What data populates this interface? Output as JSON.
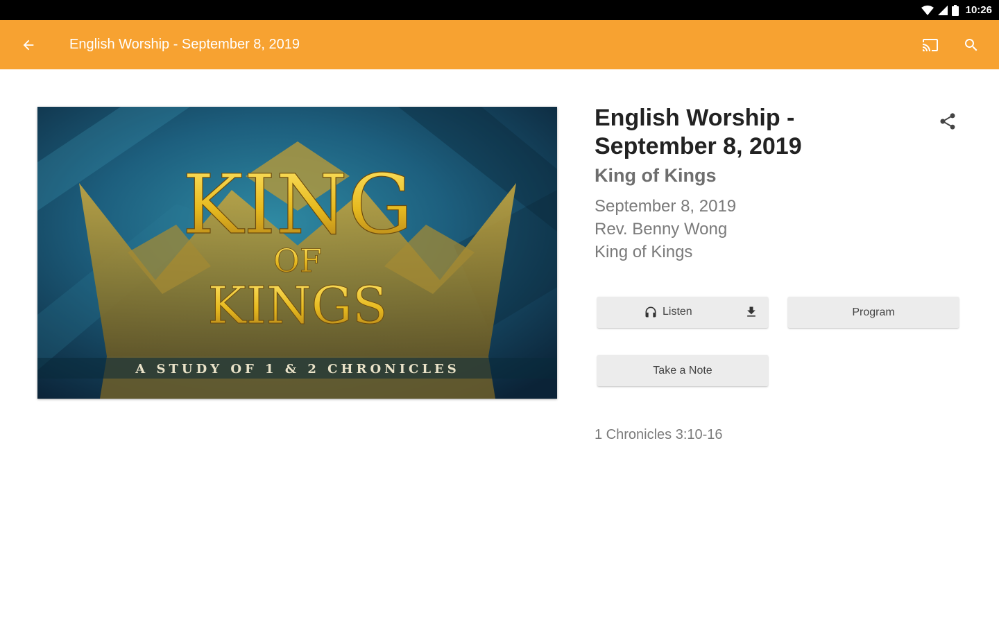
{
  "status_bar": {
    "time": "10:26",
    "icons": [
      "wifi-icon",
      "cell-signal-icon",
      "battery-icon"
    ]
  },
  "app_bar": {
    "title": "English Worship - September 8, 2019",
    "background": "#f7a231"
  },
  "artwork": {
    "title_line1": "KING",
    "title_line2": "OF",
    "title_line3": "KINGS",
    "caption": "A STUDY OF 1 & 2 CHRONICLES"
  },
  "detail": {
    "title": "English Worship - September 8, 2019",
    "subtitle": "King of Kings",
    "date": "September 8, 2019",
    "speaker": "Rev. Benny Wong",
    "series": "King of Kings"
  },
  "actions": {
    "listen": "Listen",
    "program": "Program",
    "take_note": "Take a Note"
  },
  "scripture": "1 Chronicles 3:10-16"
}
